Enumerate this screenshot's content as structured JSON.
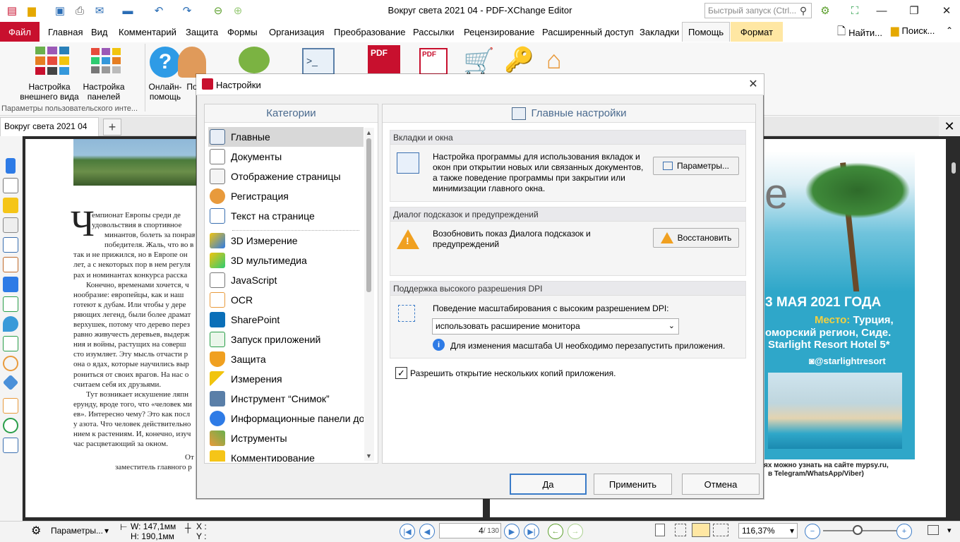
{
  "window": {
    "title": "Вокруг света 2021 04 - PDF-XChange Editor",
    "quick_launch_placeholder": "Быстрый запуск (Ctrl..."
  },
  "ribbon_tabs": [
    "Файл",
    "Главная",
    "Вид",
    "Комментарий",
    "Защита",
    "Формы",
    "Организация",
    "Преобразование",
    "Рассылки",
    "Рецензирование",
    "Расширенный доступ",
    "Закладки",
    "Помощь",
    "Формат"
  ],
  "ribbon_right": {
    "find": "Найти...",
    "search": "Поиск..."
  },
  "ribbon": {
    "btn_appearance": "Настройка внешнего вида",
    "btn_panels": "Настройка панелей",
    "btn_online_help": "Онлайн-помощь",
    "btn_support_partial": "По",
    "group_label": "Параметры пользовательского инте..."
  },
  "doc_tab": "Вокруг света 2021 04",
  "page_left": {
    "lines": [
      "емпионат Европы среди де",
      "удовольствия в спортивное",
      "минантов, болеть за понрав",
      "победителя. Жаль, что во в",
      "так и не прижился, но в Европе он",
      "лет, а с некоторых пор в нем регуля",
      "рах и номинантах конкурса расска",
      "Конечно, временами хочется, ч",
      "нообразие: европейцы, как и наш",
      "готеют к дубам. Или чтобы у дере",
      "ряющих легенд, были более драмат",
      "верхушек, потому что дерево перез",
      "равно живучесть деревьев, выдерж",
      "ния и войны, растущих на соверш",
      "сто изумляет. Эту мысль отчасти р",
      "она о ядах, которые научились выр",
      "рониться от своих врагов. На нас о",
      "считаем себя их друзьями.",
      "Тут возникает искушение ляпн",
      "ерунду, вроде того, что «человек ми",
      "ев». Интересно чему? Это как посл",
      "у азота. Что человек действительно",
      "нием к растениям. И, конечно, изуч",
      "час расцветающий за окном."
    ],
    "sig1": "От",
    "sig2": "заместитель главного р"
  },
  "page_right": {
    "big_e": "е",
    "line1": "3 МАЯ 2021 ГОДА",
    "line2_key": "Место:",
    "line2_val": " Турция,",
    "line3": "оморский регион, Сиде.",
    "line4": "Starlight Resort Hotel 5*",
    "insta": "@starlightresort",
    "foot1": "ях можно узнать на сайте mypsy.ru,",
    "foot2": "в Telegram/WhatsApp/Viber)"
  },
  "dialog": {
    "title": "Настройки",
    "categories_header": "Категории",
    "categories": [
      "Главные",
      "Документы",
      "Отображение страницы",
      "Регистрация",
      "Текст на странице",
      "3D Измерение",
      "3D мультимедиа",
      "JavaScript",
      "OCR",
      "SharePoint",
      "Запуск приложений",
      "Защита",
      "Измерения",
      "Инструмент “Снимок”",
      "Информационные панели до",
      "Иструменты",
      "Комментирование"
    ],
    "main_header": "Главные настройки",
    "sec_tabs_title": "Вкладки и окна",
    "sec_tabs_text": "Настройка программы для использования вкладок и окон при открытии новых или связанных документов, а также поведение программы при закрытии или минимизации главного окна.",
    "btn_params": "Параметры...",
    "sec_tips_title": "Диалог подсказок и предупреждений",
    "sec_tips_text": "Возобновить показ Диалога подсказок и предупреждений",
    "btn_restore": "Восстановить",
    "sec_dpi_title": "Поддержка высокого разрешения DPI",
    "dpi_label": "Поведение масштабирования с высоким разрешением DPI:",
    "dpi_value": "использовать расширение монитора",
    "dpi_note": "Для изменения масштаба UI необходимо перезапустить приложения.",
    "multi_label": "Разрешить открытие нескольких копий приложения.",
    "multi_checked": true,
    "btn_ok": "Да",
    "btn_apply": "Применить",
    "btn_cancel": "Отмена"
  },
  "status": {
    "params": "Параметры...",
    "w": "W: 147,1мм",
    "h": "H: 190,1мм",
    "x": "X :",
    "y": "Y :",
    "page_current": "4",
    "page_total": "/ 130",
    "zoom": "116,37%"
  },
  "colors": {
    "accent": "#c8102e",
    "link_blue": "#2a6db5",
    "sea": "#2fa7c9"
  }
}
